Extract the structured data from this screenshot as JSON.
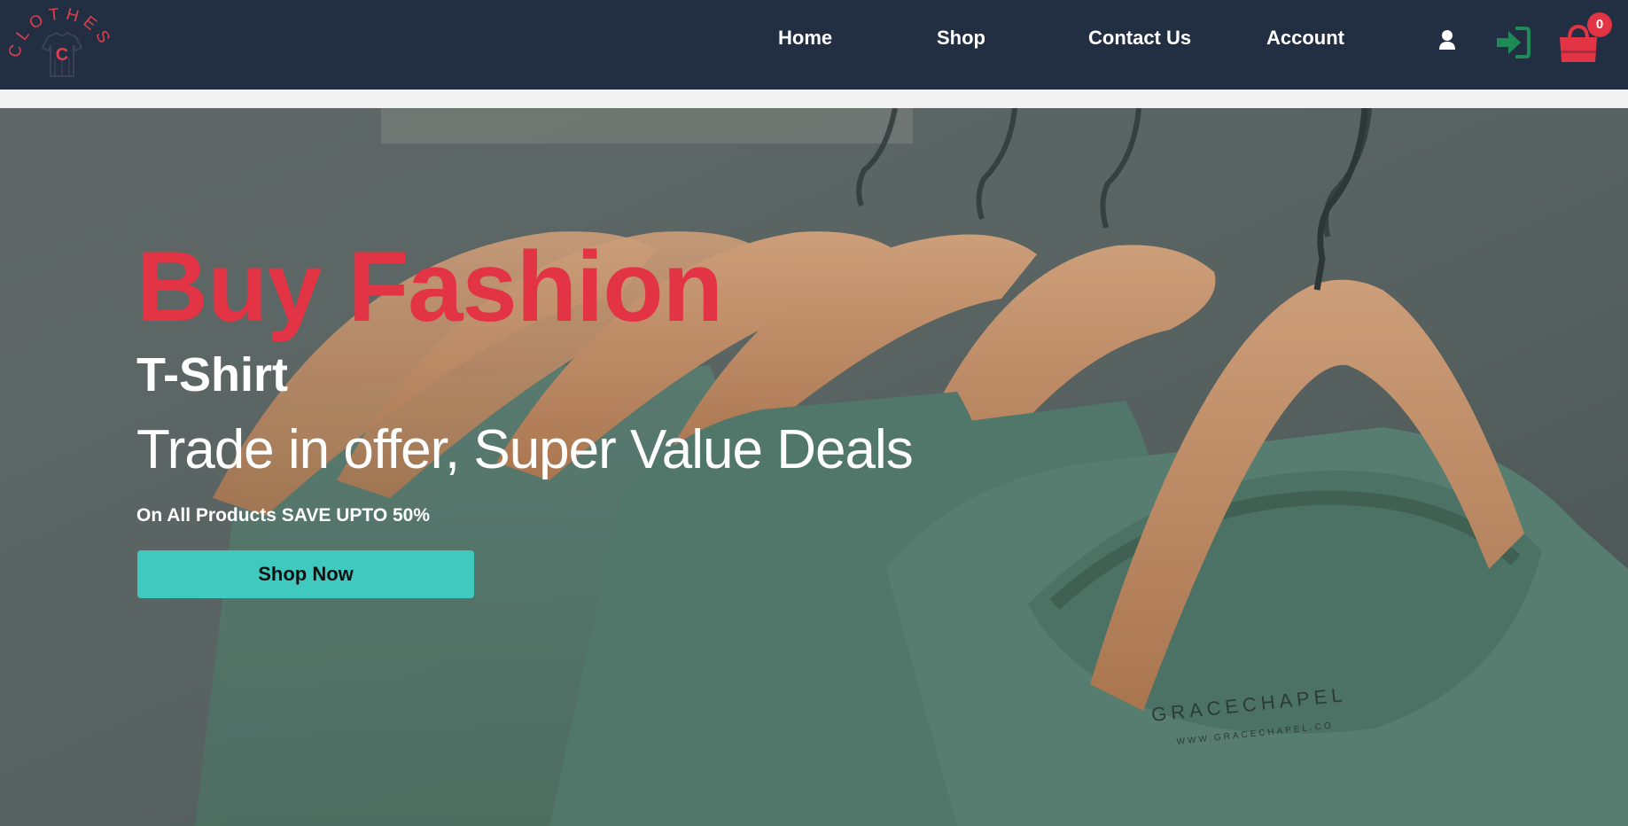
{
  "nav": {
    "logo_text": "CLOTHES",
    "logo_letter": "C",
    "links": [
      {
        "label": "Home"
      },
      {
        "label": "Shop"
      },
      {
        "label": "Contact Us"
      },
      {
        "label": "Account"
      }
    ],
    "icons": {
      "user": "user-icon",
      "login": "login-icon",
      "cart": "shopping-bag-icon"
    },
    "cart_count": "0"
  },
  "hero": {
    "title": "Buy Fashion",
    "subtitle": "T-Shirt",
    "offer": "Trade in offer, Super Value Deals",
    "save": "On All Products SAVE UPTO 50%",
    "cta": "Shop Now",
    "tag_brand": "GRACECHAPEL",
    "tag_url": "WWW.GRACECHAPEL.CO"
  },
  "colors": {
    "nav_bg": "#222e42",
    "accent_red": "#e23445",
    "button_teal": "#3fc9bf",
    "login_green": "#1f8a55"
  }
}
